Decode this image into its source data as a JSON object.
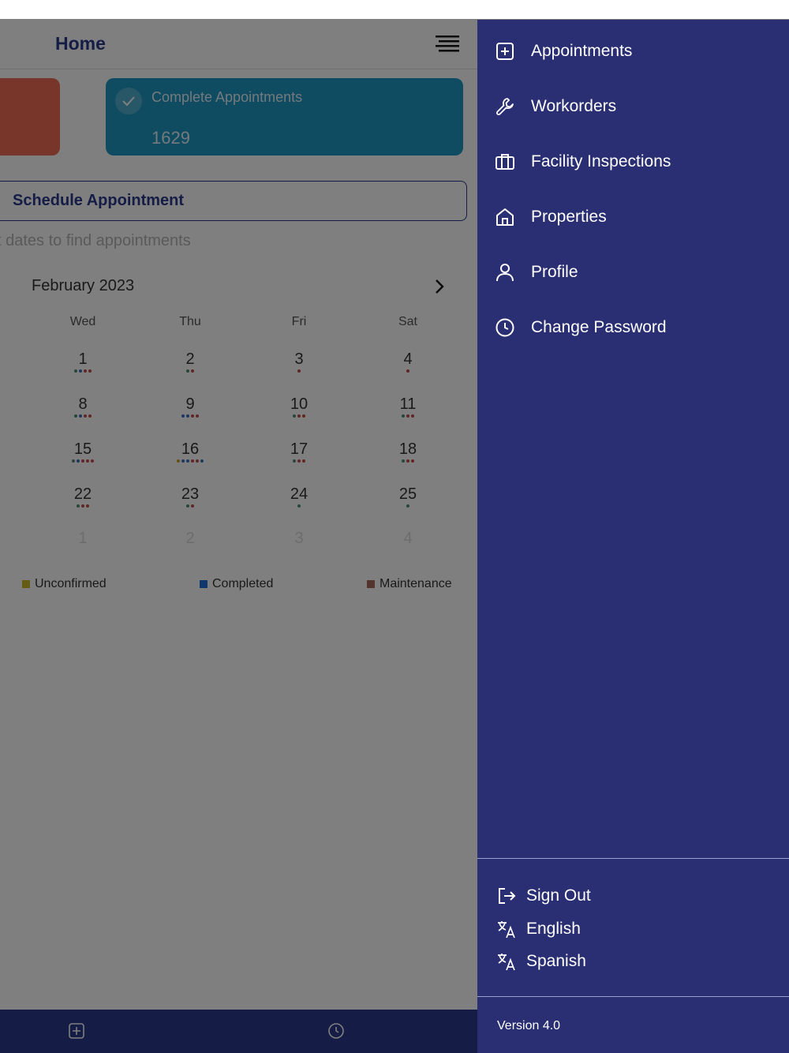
{
  "header": {
    "title": "Home"
  },
  "cards": {
    "complete": {
      "label": "Complete Appointments",
      "value": "1629"
    }
  },
  "schedule": {
    "button_label": "Schedule Appointment",
    "hint": "t dates to find appointments"
  },
  "calendar": {
    "month": "February 2023",
    "weekdays": [
      "Wed",
      "Thu",
      "Fri",
      "Sat"
    ],
    "weeks": [
      [
        "1",
        "2",
        "3",
        "4"
      ],
      [
        "8",
        "9",
        "10",
        "11"
      ],
      [
        "15",
        "16",
        "17",
        "18"
      ],
      [
        "22",
        "23",
        "24",
        "25"
      ],
      [
        "1",
        "2",
        "3",
        "4"
      ]
    ],
    "dots": [
      [
        [
          "#4a8f6e",
          "#3a6fc4",
          "#c44a4a",
          "#c44a4a"
        ],
        [
          "#4a8f6e",
          "#c44a4a"
        ],
        [
          "#c44a4a"
        ],
        [
          "#c44a4a"
        ]
      ],
      [
        [
          "#4a8f6e",
          "#3a6fc4",
          "#c44a4a",
          "#c44a4a"
        ],
        [
          "#3a6fc4",
          "#3a6fc4",
          "#c44a4a",
          "#c44a4a"
        ],
        [
          "#4a8f6e",
          "#c44a4a",
          "#c44a4a"
        ],
        [
          "#4a8f6e",
          "#c44a4a",
          "#c44a4a"
        ]
      ],
      [
        [
          "#4a8f6e",
          "#3a6fc4",
          "#c44a4a",
          "#c44a4a",
          "#c44a4a"
        ],
        [
          "#c4a020",
          "#3a6fc4",
          "#3a6fc4",
          "#c44a4a",
          "#c44a4a",
          "#3a6fc4"
        ],
        [
          "#4a8f6e",
          "#c44a4a",
          "#c44a4a"
        ],
        [
          "#4a8f6e",
          "#c44a4a",
          "#c44a4a"
        ]
      ],
      [
        [
          "#4a8f6e",
          "#c44a4a",
          "#c44a4a"
        ],
        [
          "#4a8f6e",
          "#c44a4a"
        ],
        [
          "#4a8f6e"
        ],
        [
          "#4a8f6e"
        ]
      ],
      [
        [],
        [],
        [],
        []
      ]
    ]
  },
  "legend": [
    {
      "label": "Unconfirmed",
      "color": "#c9b82a"
    },
    {
      "label": "Completed",
      "color": "#1f6fd8"
    },
    {
      "label": "Maintenance",
      "color": "#a86a5a"
    }
  ],
  "drawer": {
    "items": [
      {
        "label": "Appointments",
        "icon": "plus-square-icon"
      },
      {
        "label": "Workorders",
        "icon": "wrench-icon"
      },
      {
        "label": "Facility Inspections",
        "icon": "briefcase-icon"
      },
      {
        "label": "Properties",
        "icon": "home-icon"
      },
      {
        "label": "Profile",
        "icon": "user-icon"
      },
      {
        "label": "Change Password",
        "icon": "clock-icon"
      }
    ],
    "footer": [
      {
        "label": "Sign Out",
        "icon": "sign-out-icon"
      },
      {
        "label": "English",
        "icon": "translate-icon"
      },
      {
        "label": "Spanish",
        "icon": "translate-icon"
      }
    ],
    "version": "Version 4.0"
  },
  "colors": {
    "brand": "#2b3a8c",
    "drawer_bg": "#2a2f73",
    "card_blue": "#1f99c4",
    "card_red": "#f06b55"
  }
}
